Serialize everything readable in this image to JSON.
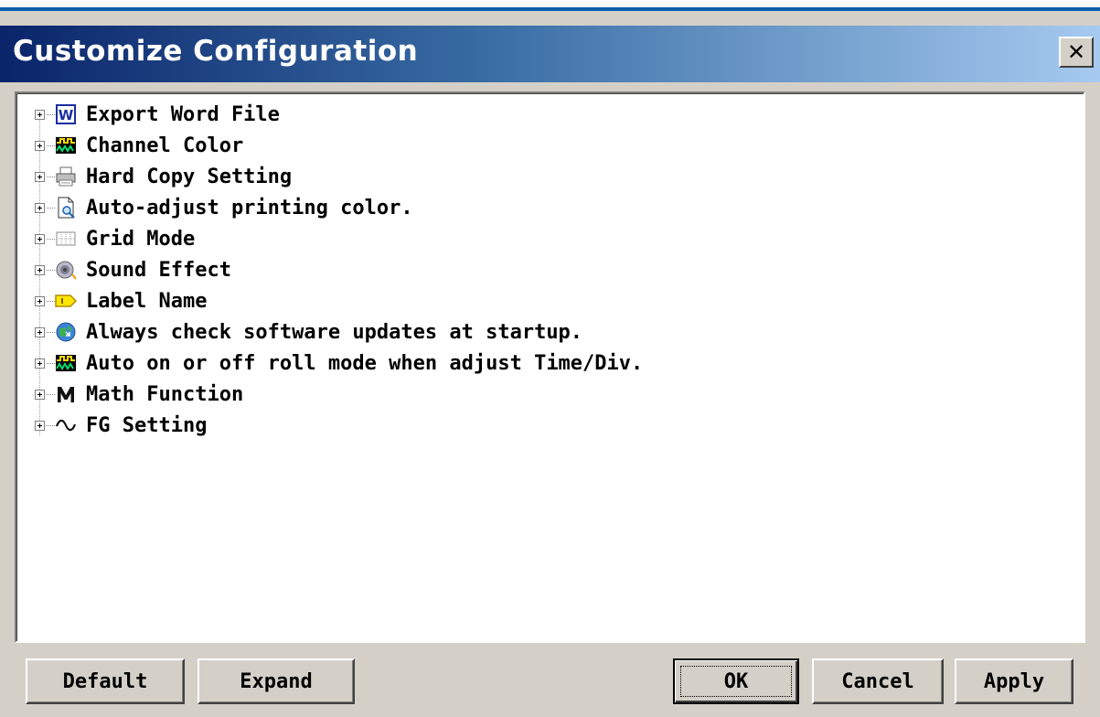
{
  "window": {
    "title": "Customize Configuration",
    "close_label": "✕"
  },
  "tree": {
    "items": [
      {
        "label": "Export Word File",
        "icon": "word-document-icon"
      },
      {
        "label": "Channel Color",
        "icon": "waveform-icon"
      },
      {
        "label": "Hard Copy Setting",
        "icon": "printer-icon"
      },
      {
        "label": "Auto-adjust printing color.",
        "icon": "print-preview-icon"
      },
      {
        "label": "Grid Mode",
        "icon": "grid-icon"
      },
      {
        "label": "Sound Effect",
        "icon": "speaker-icon"
      },
      {
        "label": "Label Name",
        "icon": "label-tag-icon"
      },
      {
        "label": "Always check software updates at startup.",
        "icon": "globe-update-icon"
      },
      {
        "label": "Auto on or off roll mode when adjust Time/Div.",
        "icon": "waveform-icon"
      },
      {
        "label": "Math Function",
        "icon": "math-m-icon"
      },
      {
        "label": "FG Setting",
        "icon": "sine-wave-icon"
      }
    ]
  },
  "buttons": {
    "default": "Default",
    "expand": "Expand",
    "ok": "OK",
    "cancel": "Cancel",
    "apply": "Apply"
  },
  "colors": {
    "titlebar_start": "#0a246a",
    "titlebar_end": "#a6caf0",
    "dialog_face": "#d4d0c8"
  }
}
